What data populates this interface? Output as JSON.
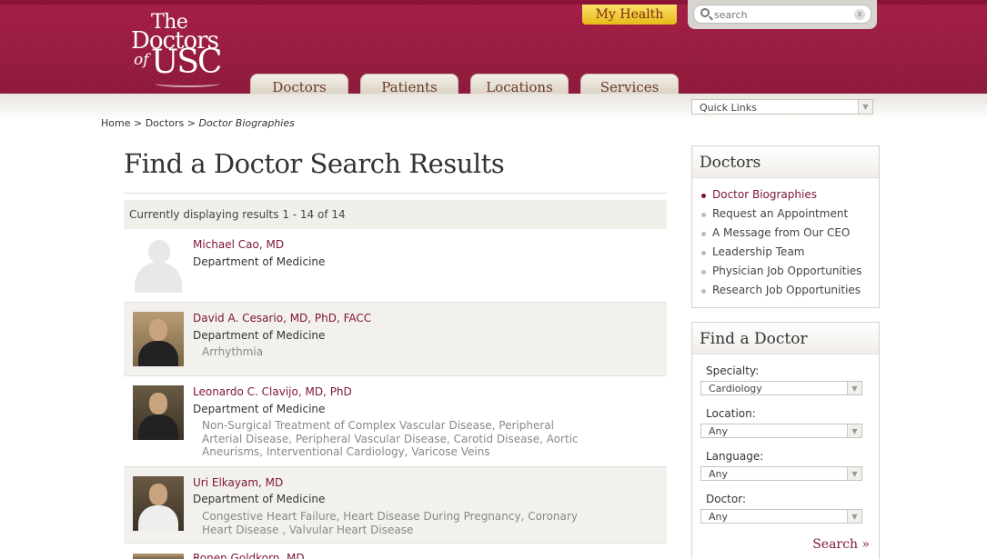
{
  "header": {
    "logo": {
      "line1": "The",
      "line2": "Doctors",
      "line3": "of",
      "line4": "USC"
    },
    "my_health": "My Health",
    "search_placeholder": "search",
    "search_clear": "x",
    "nav": [
      "Doctors",
      "Patients",
      "Locations",
      "Services"
    ]
  },
  "quick_links": {
    "label": "Quick Links",
    "arrow": "▼"
  },
  "breadcrumb": {
    "home": "Home",
    "sep1": ">",
    "doctors": "Doctors",
    "sep2": ">",
    "current": "Doctor Biographies"
  },
  "page_title": "Find a Doctor Search Results",
  "results_summary": "Currently displaying results 1 - 14 of 14",
  "doctors": [
    {
      "name": "Michael Cao, MD",
      "department": "Department of Medicine",
      "specialties": ""
    },
    {
      "name": "David A. Cesario, MD, PhD, FACC",
      "department": "Department of Medicine",
      "specialties": "Arrhythmia"
    },
    {
      "name": "Leonardo C. Clavijo, MD, PhD",
      "department": "Department of Medicine",
      "specialties": "Non-Surgical Treatment of Complex Vascular Disease, Peripheral Arterial Disease, Peripheral Vascular Disease, Carotid Disease, Aortic Aneurisms, Interventional Cardiology, Varicose Veins"
    },
    {
      "name": "Uri Elkayam, MD",
      "department": "Department of Medicine",
      "specialties": "Congestive Heart Failure, Heart Disease During Pregnancy, Coronary Heart Disease , Valvular Heart Disease"
    },
    {
      "name": "Ronen Goldkorn, MD",
      "department": "",
      "specialties": ""
    }
  ],
  "sidebar": {
    "doctors_box": {
      "title": "Doctors",
      "items": [
        "Doctor Biographies",
        "Request an Appointment",
        "A Message from Our CEO",
        "Leadership Team",
        "Physician Job Opportunities",
        "Research Job Opportunities"
      ]
    },
    "find_box": {
      "title": "Find a Doctor",
      "specialty_label": "Specialty:",
      "specialty_value": "Cardiology",
      "location_label": "Location:",
      "location_value": "Any",
      "language_label": "Language:",
      "language_value": "Any",
      "doctor_label": "Doctor:",
      "doctor_value": "Any",
      "search_label": "Search »"
    }
  },
  "colors": {
    "brand": "#a81e47",
    "link": "#7c1436",
    "gold": "#f2c83a"
  }
}
